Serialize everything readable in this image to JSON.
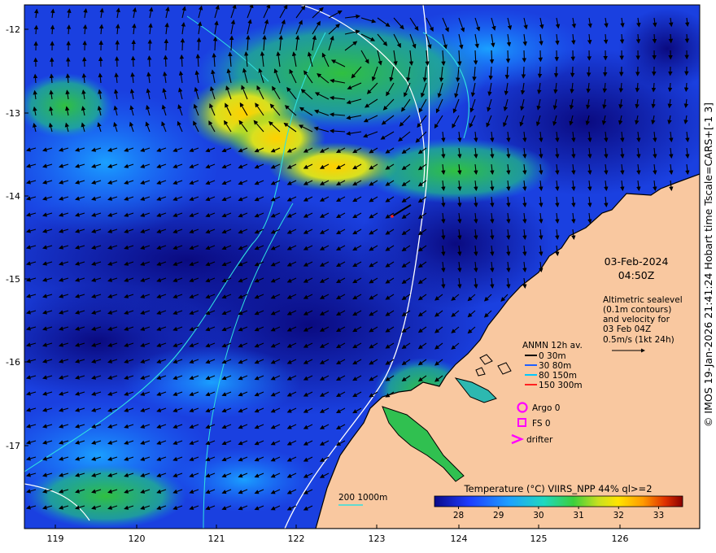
{
  "map": {
    "lon_ticks": [
      "119",
      "120",
      "121",
      "122",
      "123",
      "124",
      "125",
      "126"
    ],
    "lat_ticks": [
      "-12",
      "-13",
      "-14",
      "-15",
      "-16",
      "-17"
    ],
    "date": "03-Feb-2024",
    "time": "04:50Z",
    "altimetry_lines": [
      "Altimetric sealevel",
      "(0.1m contours)",
      "and velocity for",
      "03 Feb 04Z",
      "0.5m/s (1kt 24h)"
    ],
    "anmn": {
      "title": "ANMN 12h av.",
      "depths": [
        {
          "label": "0 30m",
          "color": "#000000"
        },
        {
          "label": "30 80m",
          "color": "#1f5fff"
        },
        {
          "label": "80 150m",
          "color": "#00c8ff"
        },
        {
          "label": "150 300m",
          "color": "#ff2020"
        }
      ]
    },
    "platforms": [
      {
        "label": "Argo 0",
        "icon": "circle-icon",
        "color": "#ff00ff"
      },
      {
        "label": "FS 0",
        "icon": "square-icon",
        "color": "#ff00ff"
      },
      {
        "label": "drifter",
        "icon": "chevron-icon",
        "color": "#ff00ff"
      }
    ],
    "isobath_label": "200  1000m",
    "colorbar": {
      "title": "Temperature (°C) VIIRS_NPP 44% ql>=2",
      "ticks": [
        "28",
        "29",
        "30",
        "31",
        "32",
        "33"
      ],
      "min": 27.4,
      "max": 33.6
    },
    "copyright": "© IMOS 19-Jan-2026 21:41:24 Hobart time Tscale=CARS+[-1 3]",
    "colors": {
      "land": "#f9c8a0",
      "cold_water": "#0a0a8a",
      "warm_water": "#ffd400",
      "contour_white": "#ffffff",
      "contour_cyan": "#30e0e0",
      "platform": "#ff00ff"
    }
  }
}
